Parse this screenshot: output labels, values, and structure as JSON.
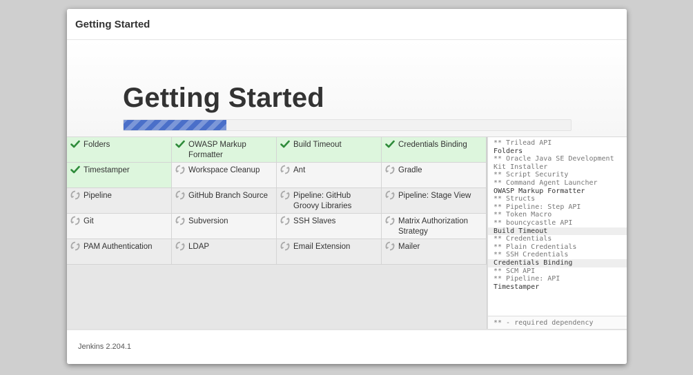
{
  "dialog": {
    "header_title": "Getting Started",
    "hero_title": "Getting Started",
    "progress": 0.23
  },
  "colors": {
    "done_bg": "#ddf6dd",
    "check": "#2e8b3a",
    "spinner": "#a8a8a8",
    "progress": "#4a6fc9"
  },
  "plugins": [
    {
      "name": "Folders",
      "status": "done"
    },
    {
      "name": "OWASP Markup Formatter",
      "status": "done"
    },
    {
      "name": "Build Timeout",
      "status": "done"
    },
    {
      "name": "Credentials Binding",
      "status": "done"
    },
    {
      "name": "Timestamper",
      "status": "done"
    },
    {
      "name": "Workspace Cleanup",
      "status": "pending"
    },
    {
      "name": "Ant",
      "status": "pending"
    },
    {
      "name": "Gradle",
      "status": "pending"
    },
    {
      "name": "Pipeline",
      "status": "pending"
    },
    {
      "name": "GitHub Branch Source",
      "status": "pending"
    },
    {
      "name": "Pipeline: GitHub Groovy Libraries",
      "status": "pending"
    },
    {
      "name": "Pipeline: Stage View",
      "status": "pending"
    },
    {
      "name": "Git",
      "status": "pending"
    },
    {
      "name": "Subversion",
      "status": "pending"
    },
    {
      "name": "SSH Slaves",
      "status": "pending"
    },
    {
      "name": "Matrix Authorization Strategy",
      "status": "pending"
    },
    {
      "name": "PAM Authentication",
      "status": "pending"
    },
    {
      "name": "LDAP",
      "status": "pending"
    },
    {
      "name": "Email Extension",
      "status": "pending"
    },
    {
      "name": "Mailer",
      "status": "pending"
    }
  ],
  "log": [
    {
      "text": "** Trilead API",
      "kind": "dep"
    },
    {
      "text": "Folders",
      "kind": "main"
    },
    {
      "text": "** Oracle Java SE Development Kit Installer",
      "kind": "dep"
    },
    {
      "text": "** Script Security",
      "kind": "dep"
    },
    {
      "text": "** Command Agent Launcher",
      "kind": "dep"
    },
    {
      "text": "OWASP Markup Formatter",
      "kind": "main"
    },
    {
      "text": "** Structs",
      "kind": "dep"
    },
    {
      "text": "** Pipeline: Step API",
      "kind": "dep"
    },
    {
      "text": "** Token Macro",
      "kind": "dep"
    },
    {
      "text": "** bouncycastle API",
      "kind": "dep"
    },
    {
      "text": "Build Timeout",
      "kind": "main-hl"
    },
    {
      "text": "** Credentials",
      "kind": "dep"
    },
    {
      "text": "** Plain Credentials",
      "kind": "dep"
    },
    {
      "text": "** SSH Credentials",
      "kind": "dep"
    },
    {
      "text": "Credentials Binding",
      "kind": "main-hl"
    },
    {
      "text": "** SCM API",
      "kind": "dep"
    },
    {
      "text": "** Pipeline: API",
      "kind": "dep"
    },
    {
      "text": "Timestamper",
      "kind": "main"
    }
  ],
  "log_footer": "** - required dependency",
  "version": "Jenkins 2.204.1"
}
